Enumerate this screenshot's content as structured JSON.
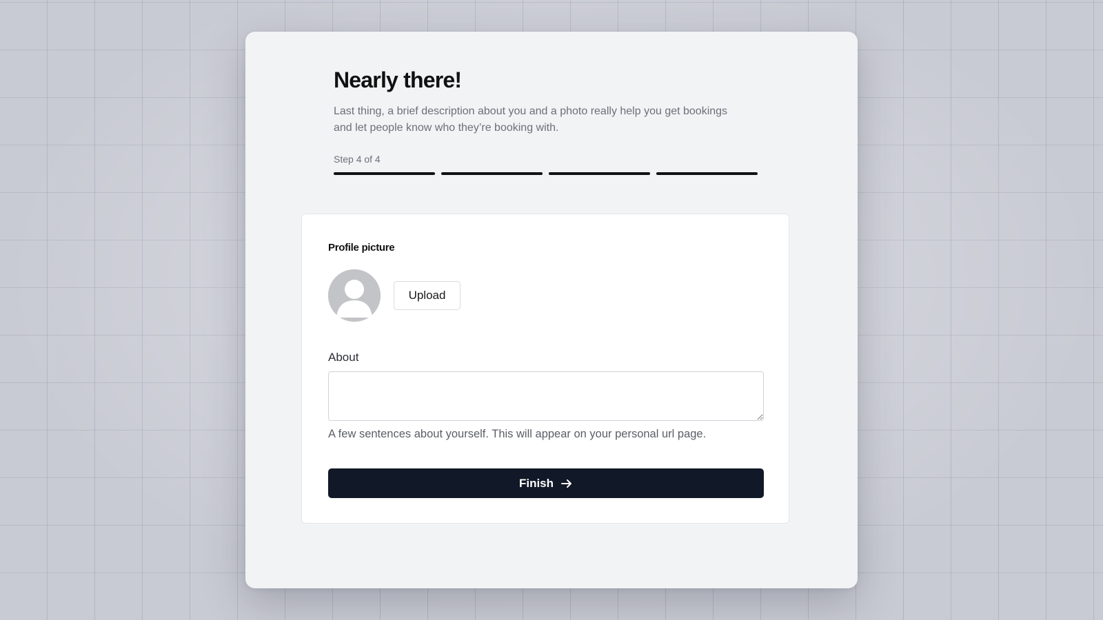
{
  "header": {
    "title": "Nearly there!",
    "subtitle": "Last thing, a brief description about you and a photo really help you get bookings and let people know who they’re booking with.",
    "step_text": "Step 4 of 4",
    "steps_total": 4,
    "steps_completed": 4,
    "step_color": "#111111"
  },
  "profile": {
    "label": "Profile picture",
    "avatar_icon": "default-user-avatar",
    "upload_label": "Upload"
  },
  "about": {
    "label": "About",
    "value": "",
    "placeholder": "",
    "helper": "A few sentences about yourself. This will appear on your personal url page."
  },
  "actions": {
    "finish_label": "Finish",
    "finish_icon": "arrow-right-icon",
    "primary_color": "#111827"
  }
}
